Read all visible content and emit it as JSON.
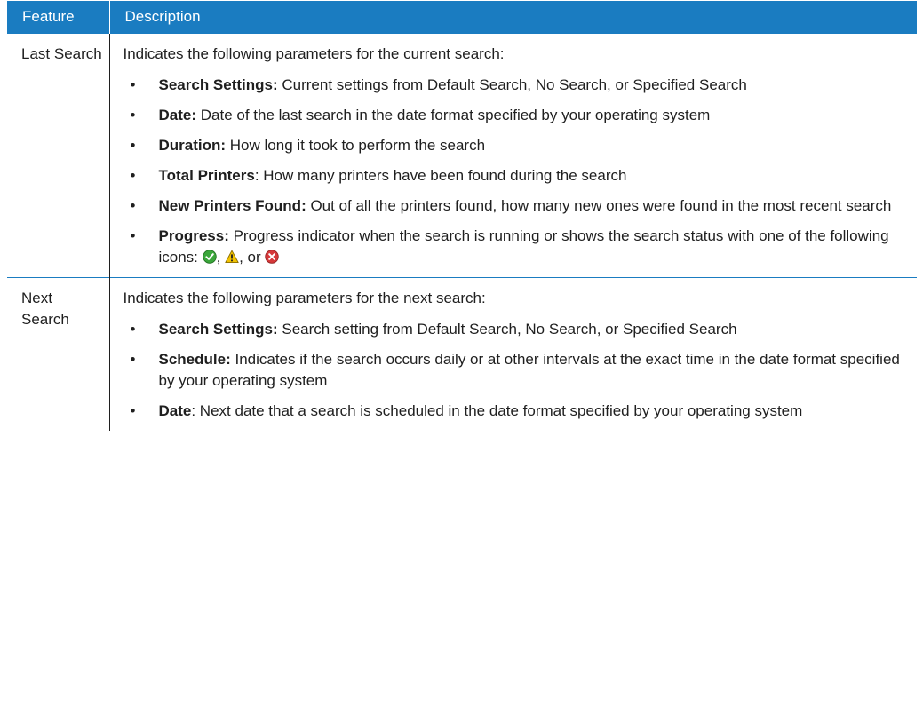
{
  "table": {
    "headers": {
      "feature": "Feature",
      "description": "Description"
    },
    "rows": [
      {
        "feature": "Last Search",
        "intro": "Indicates the following parameters for the current search:",
        "items": [
          {
            "term": "Search Settings:",
            "text": " Current settings from Default Search, No Search, or Specified Search"
          },
          {
            "term": "Date:",
            "text": " Date of the last search in the date format specified by your operating system"
          },
          {
            "term": "Duration:",
            "text": " How long it took to perform the search"
          },
          {
            "term": "Total Printers",
            "text": ": How many printers have been found during the search"
          },
          {
            "term": "New Printers Found:",
            "text": " Out of all the printers found, how many new ones were found in the most recent search"
          },
          {
            "term": "Progress:",
            "text": " Progress indicator when the search is running or shows the search status with one of the following icons: ",
            "icon_sep_1": ", ",
            "icon_sep_2": ", or ",
            "icons": [
              "success-icon",
              "warning-icon",
              "error-icon"
            ]
          }
        ]
      },
      {
        "feature": "Next Search",
        "intro": "Indicates the following parameters for the next search:",
        "items": [
          {
            "term": "Search Settings:",
            "text": " Search setting from Default Search, No Search, or Specified Search"
          },
          {
            "term": "Schedule:",
            "text": " Indicates if the search occurs daily or at other intervals at the exact time in the date format specified by your operating system"
          },
          {
            "term": "Date",
            "text": ": Next date that a search is scheduled in the date format specified by your operating system"
          }
        ]
      }
    ]
  },
  "colors": {
    "header_background": "#1a7cc1",
    "header_text": "#ffffff",
    "success": "#3aa63a",
    "warning": "#f2c200",
    "error": "#d6383a"
  }
}
